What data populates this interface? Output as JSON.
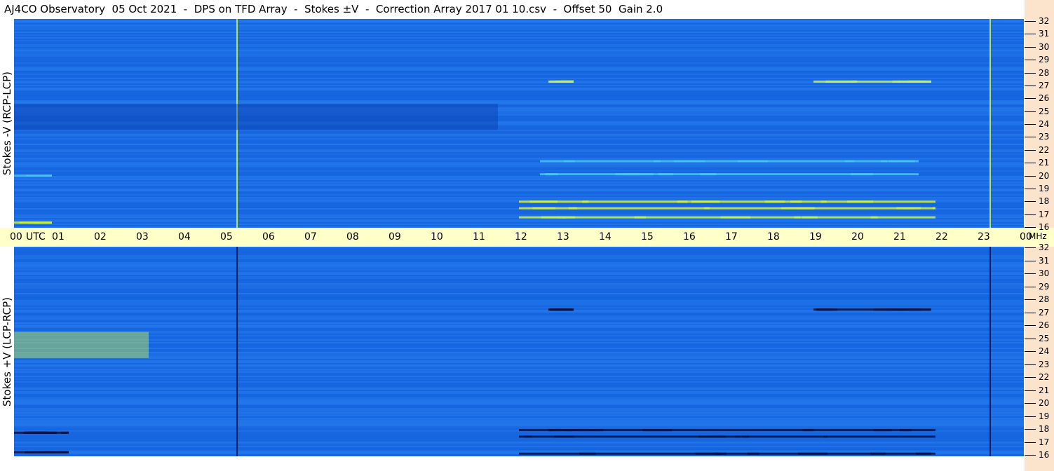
{
  "title": "AJ4CO Observatory  05 Oct 2021  -  DPS on TFD Array  -  Stokes ±V  -  Correction Array 2017 01 10.csv  -  Offset 50  Gain 2.0",
  "panels": {
    "top": {
      "label": "Stokes -V (RCP-LCP)"
    },
    "bottom": {
      "label": "Stokes +V (LCP-RCP)"
    }
  },
  "time_axis": {
    "ticks": [
      "00",
      "01",
      "02",
      "03",
      "04",
      "05",
      "06",
      "07",
      "08",
      "09",
      "10",
      "11",
      "12",
      "13",
      "14",
      "15",
      "16",
      "17",
      "18",
      "19",
      "20",
      "21",
      "22",
      "23",
      "00"
    ],
    "unit": "UTC",
    "freq_unit": "MHz"
  },
  "freq_axis": {
    "ticks": [
      "32",
      "31",
      "30",
      "29",
      "28",
      "27",
      "26",
      "25",
      "24",
      "23",
      "22",
      "21",
      "20",
      "19",
      "18",
      "17",
      "16"
    ]
  },
  "colors": {
    "background_blue": "#1a6ee6",
    "time_axis_bg": "#ffffc8",
    "freq_axis_bg": "#fce3cc"
  },
  "chart_data": [
    {
      "type": "heatmap",
      "name": "Stokes -V (RCP-LCP)",
      "x_range_utc_hours": [
        0,
        24
      ],
      "y_range_mhz": [
        16,
        32
      ],
      "features": [
        {
          "kind": "band",
          "t_start": 12.7,
          "t_end": 13.3,
          "f_mhz": 27.2,
          "level": "high"
        },
        {
          "kind": "band",
          "t_start": 19.0,
          "t_end": 21.8,
          "f_mhz": 27.2,
          "level": "high"
        },
        {
          "kind": "band",
          "t_start": 12.0,
          "t_end": 21.9,
          "f_mhz": 17.5,
          "level": "high"
        },
        {
          "kind": "band",
          "t_start": 12.0,
          "t_end": 21.9,
          "f_mhz": 18.0,
          "level": "high"
        },
        {
          "kind": "band",
          "t_start": 12.0,
          "t_end": 21.9,
          "f_mhz": 16.8,
          "level": "high"
        },
        {
          "kind": "band",
          "t_start": 12.5,
          "t_end": 21.5,
          "f_mhz": 20.1,
          "level": "medium"
        },
        {
          "kind": "band",
          "t_start": 12.5,
          "t_end": 21.5,
          "f_mhz": 21.1,
          "level": "medium"
        },
        {
          "kind": "band",
          "t_start": 0.0,
          "t_end": 0.9,
          "f_mhz": 16.4,
          "level": "high"
        },
        {
          "kind": "band",
          "t_start": 0.0,
          "t_end": 0.9,
          "f_mhz": 20.0,
          "level": "medium"
        },
        {
          "kind": "vline",
          "t": 5.3,
          "level": "high"
        },
        {
          "kind": "vline",
          "t": 23.2,
          "level": "high"
        },
        {
          "kind": "region",
          "t_start": 0.0,
          "t_end": 11.5,
          "f_lo": 23.5,
          "f_hi": 25.5,
          "level": "low"
        }
      ]
    },
    {
      "type": "heatmap",
      "name": "Stokes +V (LCP-RCP)",
      "x_range_utc_hours": [
        0,
        24
      ],
      "y_range_mhz": [
        16,
        32
      ],
      "features": [
        {
          "kind": "band",
          "t_start": 12.7,
          "t_end": 13.3,
          "f_mhz": 27.2,
          "level": "very_low"
        },
        {
          "kind": "band",
          "t_start": 19.0,
          "t_end": 21.8,
          "f_mhz": 27.2,
          "level": "very_low"
        },
        {
          "kind": "band",
          "t_start": 12.0,
          "t_end": 21.9,
          "f_mhz": 17.5,
          "level": "very_low"
        },
        {
          "kind": "band",
          "t_start": 12.0,
          "t_end": 21.9,
          "f_mhz": 18.0,
          "level": "very_low"
        },
        {
          "kind": "band",
          "t_start": 12.0,
          "t_end": 21.9,
          "f_mhz": 16.2,
          "level": "very_low"
        },
        {
          "kind": "band",
          "t_start": 0.0,
          "t_end": 1.3,
          "f_mhz": 17.8,
          "level": "very_low"
        },
        {
          "kind": "band",
          "t_start": 0.0,
          "t_end": 1.3,
          "f_mhz": 16.3,
          "level": "very_low"
        },
        {
          "kind": "vline",
          "t": 5.3,
          "level": "very_low"
        },
        {
          "kind": "vline",
          "t": 23.2,
          "level": "very_low"
        },
        {
          "kind": "region",
          "t_start": 0.0,
          "t_end": 3.2,
          "f_lo": 23.5,
          "f_hi": 25.5,
          "level": "high"
        }
      ]
    }
  ]
}
